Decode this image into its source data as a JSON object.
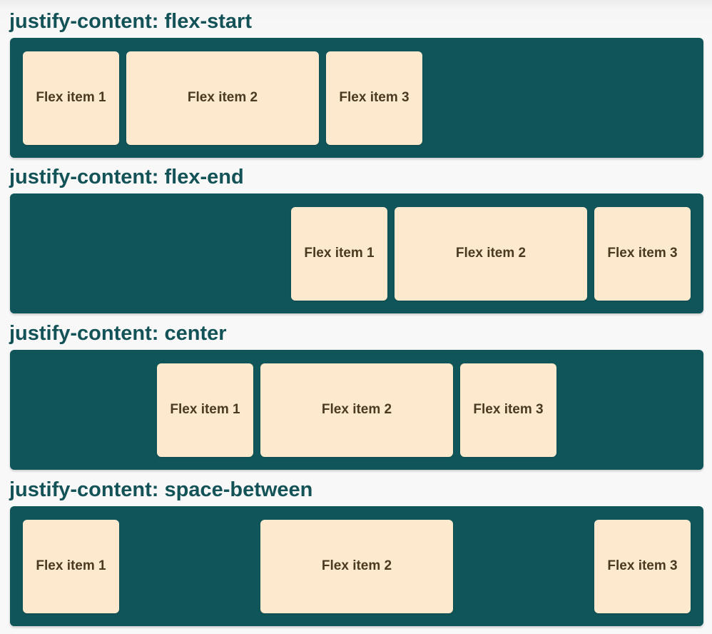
{
  "colors": {
    "heading_text": "#135257",
    "container_bg": "#10555a",
    "item_bg": "#fde9cd",
    "item_text": "#4a3a22"
  },
  "sections": [
    {
      "title": "justify-content: flex-start",
      "justify": "flex-start",
      "items": [
        "Flex item 1",
        "Flex item 2",
        "Flex item 3"
      ]
    },
    {
      "title": "justify-content: flex-end",
      "justify": "flex-end",
      "items": [
        "Flex item 1",
        "Flex item 2",
        "Flex item 3"
      ]
    },
    {
      "title": "justify-content: center",
      "justify": "center",
      "items": [
        "Flex item 1",
        "Flex item 2",
        "Flex item 3"
      ]
    },
    {
      "title": "justify-content: space-between",
      "justify": "space-between",
      "items": [
        "Flex item 1",
        "Flex item 2",
        "Flex item 3"
      ]
    }
  ]
}
